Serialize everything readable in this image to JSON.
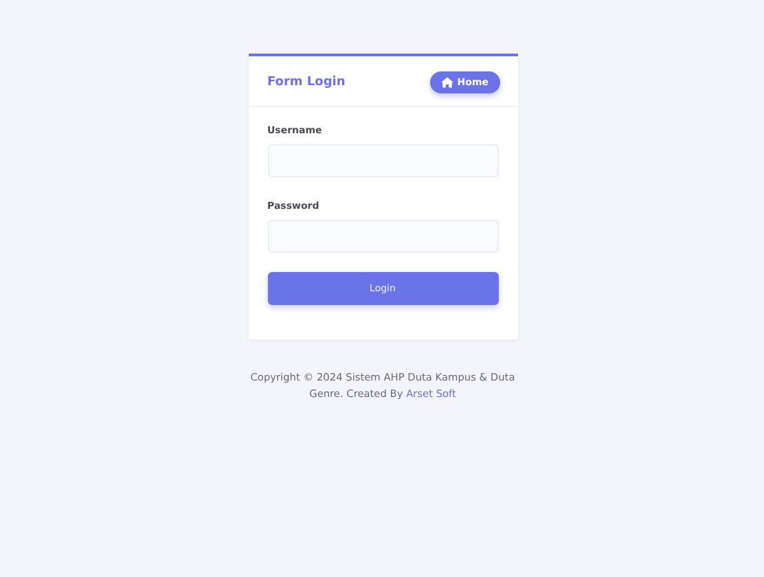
{
  "card": {
    "title": "Form Login",
    "home_button": "Home",
    "fields": [
      {
        "label": "Username"
      },
      {
        "label": "Password"
      }
    ],
    "submit": "Login"
  },
  "footer": {
    "text": "Copyright © 2024 Sistem AHP Duta Kampus & Duta Genre. Created By",
    "link": "Arset Soft"
  }
}
